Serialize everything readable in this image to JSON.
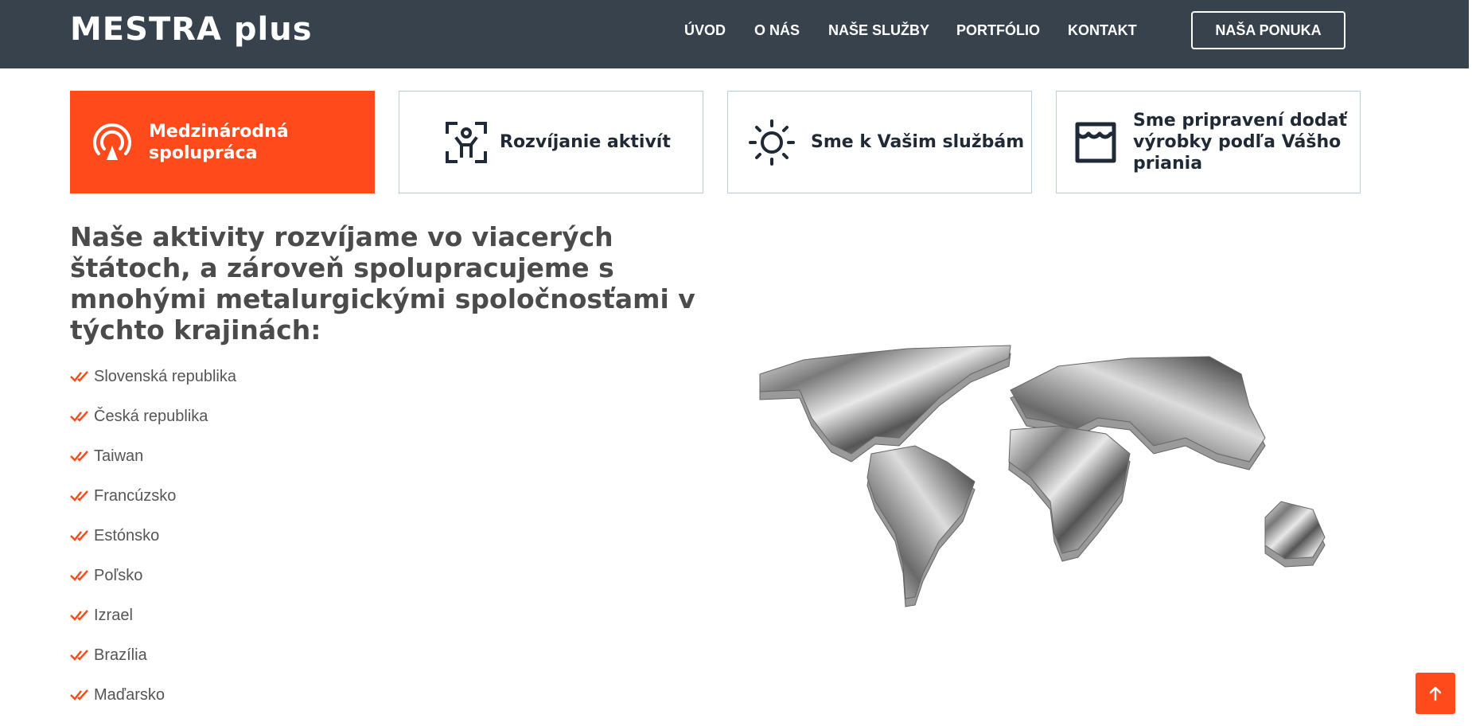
{
  "header": {
    "logo": "MESTRA plus",
    "nav": [
      {
        "label": "ÚVOD"
      },
      {
        "label": "O NÁS"
      },
      {
        "label": "NAŠE SLUŽBY"
      },
      {
        "label": "PORTFÓLIO"
      },
      {
        "label": "KONTAKT"
      }
    ],
    "cta_label": "NAŠA PONUKA"
  },
  "features": [
    {
      "label": "Medzinárodná spolupráca",
      "icon": "radar-icon",
      "active": true
    },
    {
      "label": "Rozvíjanie aktivít",
      "icon": "person-focus-icon",
      "active": false
    },
    {
      "label": "Sme k Vašim službám",
      "icon": "sun-icon",
      "active": false
    },
    {
      "label": "Sme pripravení dodať výrobky podľa Vášho priania",
      "icon": "shop-icon",
      "active": false
    }
  ],
  "main": {
    "heading": "Naše aktivity rozvíjame vo viacerých štátoch, a zároveň spolupracujeme s mnohými metalurgickými spoločnosťami v týchto krajinách:",
    "countries": [
      "Slovenská republika",
      "Česká republika",
      "Taiwan",
      "Francúzsko",
      "Estónsko",
      "Poľsko",
      "Izrael",
      "Brazília",
      "Maďarsko"
    ],
    "map_icon": "world-map-image"
  },
  "to_top_icon": "arrow-up-icon",
  "colors": {
    "header_bg": "#37424d",
    "accent": "#ff4b1c",
    "dark_text": "#1f2a36"
  }
}
